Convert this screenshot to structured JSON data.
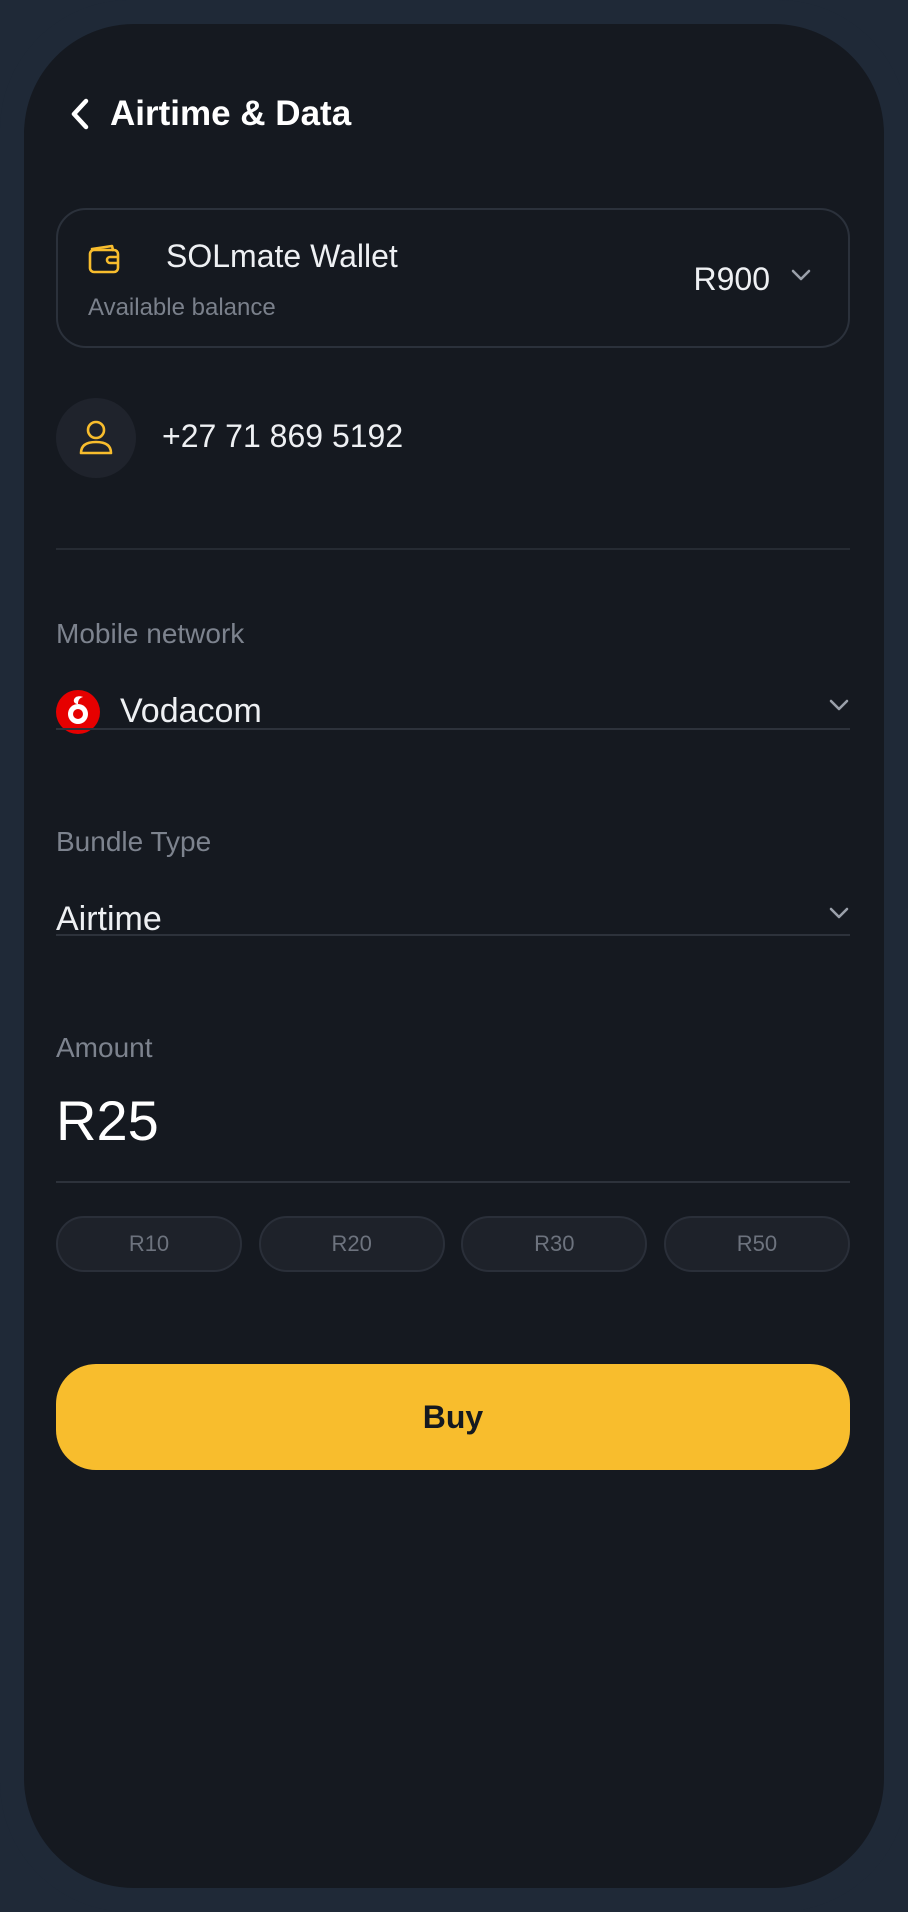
{
  "header": {
    "title": "Airtime & Data",
    "back_icon": "chevron-left-icon"
  },
  "wallet": {
    "name": "SOLmate Wallet",
    "subtitle": "Available balance",
    "balance": "R900",
    "icon": "wallet-icon",
    "accent_color": "#f8bd2d"
  },
  "contact": {
    "phone_number": "+27 71 869 5192",
    "icon": "user-icon"
  },
  "mobile_network": {
    "label": "Mobile network",
    "selected": "Vodacom",
    "logo": "vodacom-logo",
    "logo_color": "#e60000"
  },
  "bundle_type": {
    "label": "Bundle Type",
    "selected": "Airtime"
  },
  "amount": {
    "label": "Amount",
    "value": "R25",
    "quick_amounts": [
      "R10",
      "R20",
      "R30",
      "R50"
    ]
  },
  "buy_button": {
    "label": "Buy",
    "color": "#f8bd2d"
  }
}
